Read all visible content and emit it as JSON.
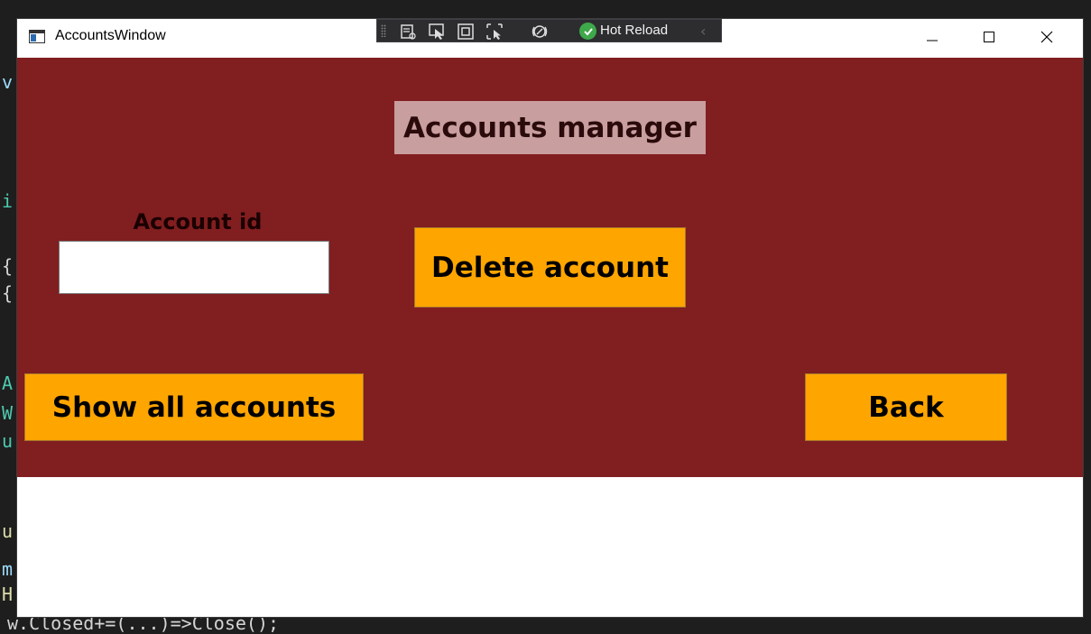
{
  "window": {
    "title": "AccountsWindow"
  },
  "hot_reload_toolbar": {
    "label": "Hot Reload",
    "icons": [
      "live-visual-tree-icon",
      "select-element-icon",
      "display-layout-adorners-icon",
      "track-focused-element-icon",
      "binding-failures-icon"
    ]
  },
  "main": {
    "heading": "Accounts manager",
    "account_id_label": "Account id",
    "account_id_value": "",
    "delete_button": "Delete account",
    "show_all_button": "Show all accounts",
    "back_button": "Back"
  },
  "background_code": {
    "bottom_line": "w.Closed+=(...)=>Close();"
  },
  "colors": {
    "client_background": "#811e20",
    "heading_background": "#c89e9f",
    "button_background": "#ffa500",
    "lower_area": "#ffffff"
  }
}
